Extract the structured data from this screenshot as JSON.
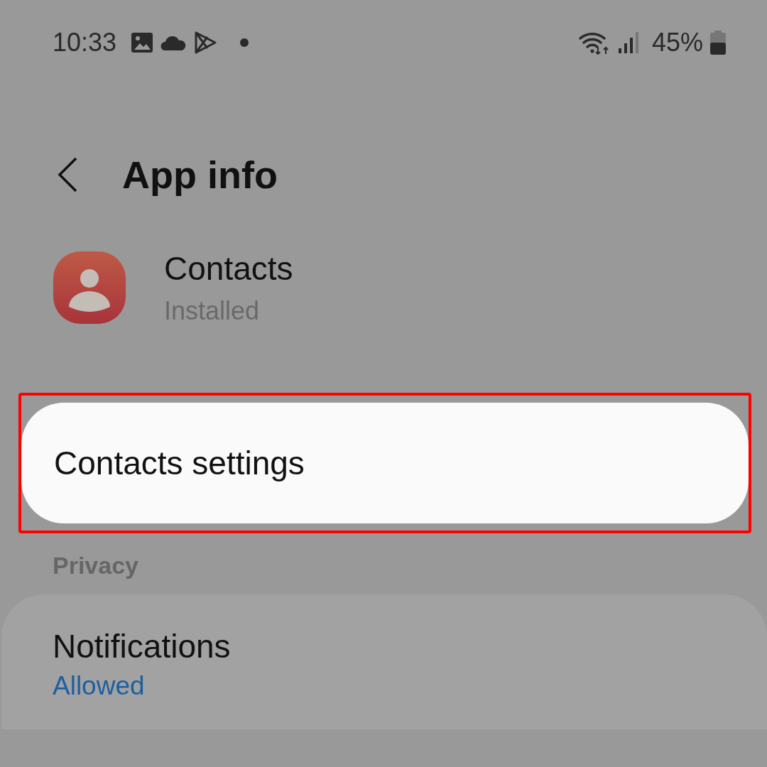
{
  "status_bar": {
    "time": "10:33",
    "battery": "45%"
  },
  "header": {
    "title": "App info"
  },
  "app": {
    "name": "Contacts",
    "status": "Installed"
  },
  "items": [
    {
      "label": "Contacts settings",
      "highlighted": true
    }
  ],
  "sections": [
    {
      "heading": "Privacy",
      "items": [
        {
          "title": "Notifications",
          "value": "Allowed"
        }
      ]
    }
  ]
}
